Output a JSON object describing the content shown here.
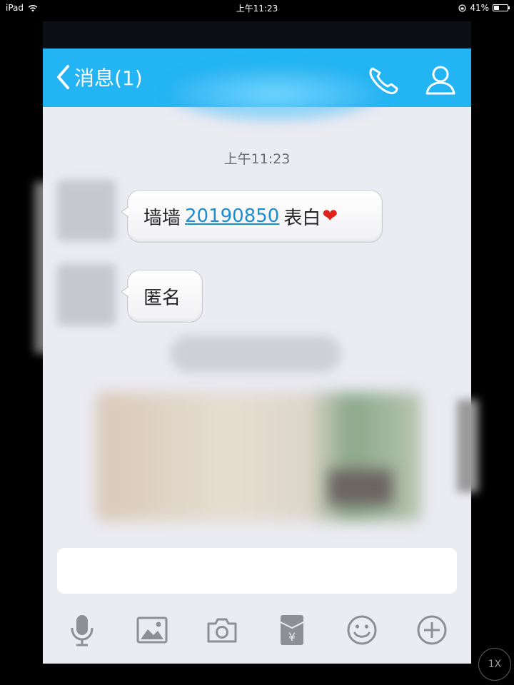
{
  "status_bar": {
    "device": "iPad",
    "time": "上午11:23",
    "battery": "41%",
    "battery_level": 0.41
  },
  "nav": {
    "back_label": "消息(1)"
  },
  "chat": {
    "timestamp": "上午11:23",
    "messages": [
      {
        "prefix": "墙墙",
        "link": "20190850",
        "suffix": "表白",
        "emoji": "❤"
      },
      {
        "text": "匿名"
      }
    ]
  },
  "input": {
    "placeholder": ""
  },
  "toolbar": {
    "icons": [
      "microphone-icon",
      "image-icon",
      "camera-icon",
      "red-packet-icon",
      "emoji-icon",
      "plus-icon"
    ]
  },
  "zoom_badge": "1X"
}
